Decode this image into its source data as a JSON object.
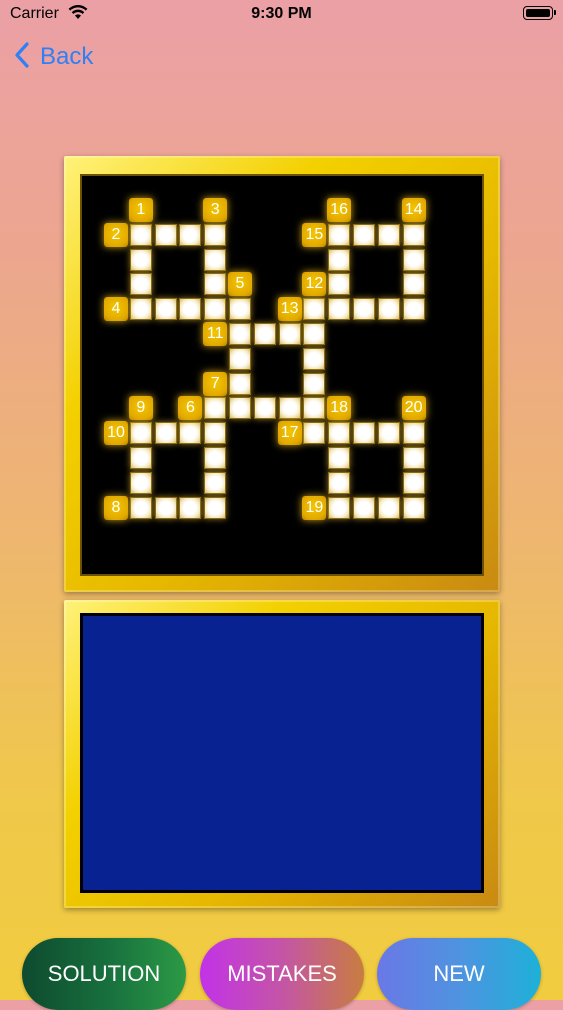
{
  "status_bar": {
    "carrier": "Carrier",
    "time": "9:30 PM"
  },
  "nav": {
    "back_label": "Back",
    "back_icon": "chevron-left-icon"
  },
  "colors": {
    "accent": "#2f7ff6",
    "board_background": "#000000",
    "answer_panel": "#082291",
    "frame_gold": "#f3d000"
  },
  "puzzle": {
    "numbers": [
      {
        "label": "1",
        "col": 1,
        "row": 0
      },
      {
        "label": "3",
        "col": 4,
        "row": 0
      },
      {
        "label": "16",
        "col": 9,
        "row": 0
      },
      {
        "label": "14",
        "col": 12,
        "row": 0
      },
      {
        "label": "2",
        "col": 0,
        "row": 1
      },
      {
        "label": "15",
        "col": 8,
        "row": 1
      },
      {
        "label": "5",
        "col": 5,
        "row": 3
      },
      {
        "label": "12",
        "col": 8,
        "row": 3
      },
      {
        "label": "4",
        "col": 0,
        "row": 4
      },
      {
        "label": "13",
        "col": 7,
        "row": 4
      },
      {
        "label": "11",
        "col": 4,
        "row": 5
      },
      {
        "label": "7",
        "col": 4,
        "row": 7
      },
      {
        "label": "9",
        "col": 1,
        "row": 8
      },
      {
        "label": "6",
        "col": 3,
        "row": 8
      },
      {
        "label": "18",
        "col": 9,
        "row": 8
      },
      {
        "label": "20",
        "col": 12,
        "row": 8
      },
      {
        "label": "10",
        "col": 0,
        "row": 9
      },
      {
        "label": "17",
        "col": 7,
        "row": 9
      },
      {
        "label": "8",
        "col": 0,
        "row": 12
      },
      {
        "label": "19",
        "col": 8,
        "row": 12
      }
    ],
    "cells": [
      [
        1,
        1
      ],
      [
        2,
        1
      ],
      [
        3,
        1
      ],
      [
        4,
        1
      ],
      [
        9,
        1
      ],
      [
        10,
        1
      ],
      [
        11,
        1
      ],
      [
        12,
        1
      ],
      [
        1,
        2
      ],
      [
        4,
        2
      ],
      [
        9,
        2
      ],
      [
        12,
        2
      ],
      [
        1,
        3
      ],
      [
        4,
        3
      ],
      [
        9,
        3
      ],
      [
        12,
        3
      ],
      [
        1,
        4
      ],
      [
        2,
        4
      ],
      [
        3,
        4
      ],
      [
        4,
        4
      ],
      [
        5,
        4
      ],
      [
        8,
        4
      ],
      [
        9,
        4
      ],
      [
        10,
        4
      ],
      [
        11,
        4
      ],
      [
        12,
        4
      ],
      [
        5,
        5
      ],
      [
        6,
        5
      ],
      [
        7,
        5
      ],
      [
        8,
        5
      ],
      [
        5,
        6
      ],
      [
        8,
        6
      ],
      [
        5,
        7
      ],
      [
        8,
        7
      ],
      [
        4,
        8
      ],
      [
        5,
        8
      ],
      [
        6,
        8
      ],
      [
        7,
        8
      ],
      [
        8,
        8
      ],
      [
        1,
        9
      ],
      [
        2,
        9
      ],
      [
        3,
        9
      ],
      [
        4,
        9
      ],
      [
        8,
        9
      ],
      [
        9,
        9
      ],
      [
        10,
        9
      ],
      [
        11,
        9
      ],
      [
        12,
        9
      ],
      [
        1,
        10
      ],
      [
        4,
        10
      ],
      [
        9,
        10
      ],
      [
        12,
        10
      ],
      [
        1,
        11
      ],
      [
        4,
        11
      ],
      [
        9,
        11
      ],
      [
        12,
        11
      ],
      [
        1,
        12
      ],
      [
        2,
        12
      ],
      [
        3,
        12
      ],
      [
        4,
        12
      ],
      [
        9,
        12
      ],
      [
        10,
        12
      ],
      [
        11,
        12
      ],
      [
        12,
        12
      ]
    ]
  },
  "buttons": {
    "solution": "SOLUTION",
    "mistakes": "MISTAKES",
    "new": "NEW"
  }
}
